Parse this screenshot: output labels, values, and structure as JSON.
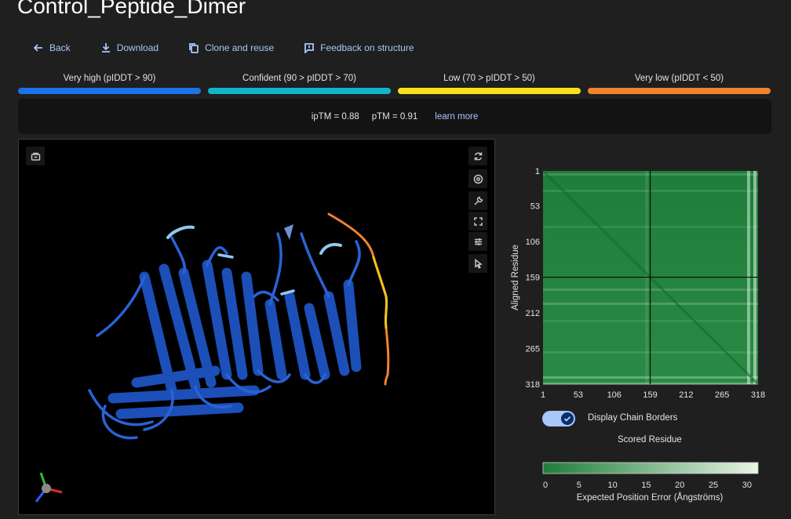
{
  "header": {
    "title": "Control_Peptide_Dimer"
  },
  "actions": {
    "back": "Back",
    "download": "Download",
    "clone": "Clone and reuse",
    "feedback": "Feedback on structure"
  },
  "plddt_legend": [
    {
      "label": "Very high (pIDDT > 90)",
      "color": "#1a73e8"
    },
    {
      "label": "Confident (90 > pIDDT > 70)",
      "color": "#12b5cb"
    },
    {
      "label": "Low (70 > pIDDT > 50)",
      "color": "#f9e11a"
    },
    {
      "label": "Very low (pIDDT < 50)",
      "color": "#f0832e"
    }
  ],
  "metrics": {
    "iptm": "ipTM = 0.88",
    "ptm": "pTM = 0.91",
    "learn_more": "learn more"
  },
  "chart_data": {
    "type": "heatmap",
    "ylabel": "Aligned Residue",
    "xlabel": "Scored Residue",
    "x_ticks": [
      1,
      53,
      106,
      159,
      212,
      265,
      318
    ],
    "y_ticks": [
      1,
      53,
      106,
      159,
      212,
      265,
      318
    ],
    "range": [
      1,
      318
    ],
    "chain_border": 159,
    "colorbar_label": "Expected Position Error (Ångströms)",
    "colorbar_ticks": [
      0,
      5,
      10,
      15,
      20,
      25,
      30
    ],
    "colorbar_range": [
      0,
      32
    ],
    "colors": {
      "low": "#1e7d3a",
      "high": "#e8f5e4"
    }
  },
  "controls": {
    "chain_borders_label": "Display Chain Borders",
    "chain_borders_on": true
  }
}
